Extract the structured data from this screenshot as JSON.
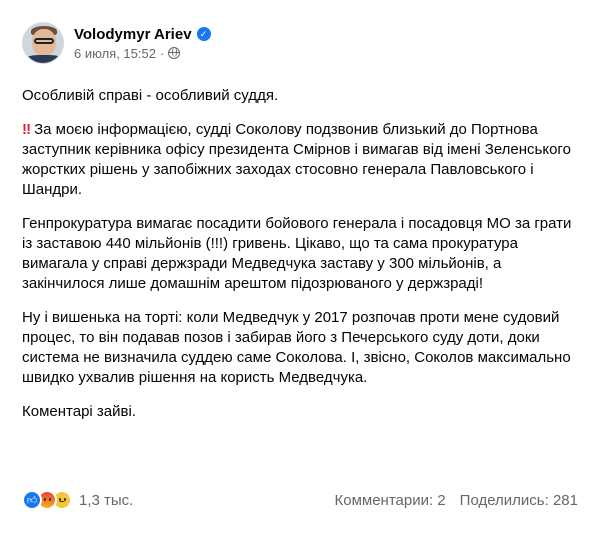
{
  "post": {
    "author": "Volodymyr Ariev",
    "date": "6 июля, 15:52",
    "dot": "·",
    "paragraphs": [
      "Особливій справі - особливий суддя.",
      "За моєю інформацією, судді Соколову подзвонив близький до Портнова заступник керівника офісу президента Смірнов і вимагав від імені Зеленського жорстких рішень у запобіжних заходах стосовно генерала Павловського і Шандри.",
      "Генпрокуратура вимагає посадити бойового генерала і посадовця МО за грати із заставою 440 мільйонів (!!!) гривень. Цікаво, що та сама прокуратура вимагала у справі держзради Медведчука заставу у 300 мільйонів, а закінчилося лише домашнім арештом підозрюваного у держзраді!",
      "Ну і вишенька на торті: коли Медведчук у 2017 розпочав проти мене судовий процес, то він подавав позов і забирав його з Печерського суду доти, доки система не визначила суддею саме Соколова. І, звісно, Соколов максимально швидко ухвалив рішення на користь Медведчука.",
      "Коментарі зайві."
    ],
    "alert_icon": "‼",
    "reactions": {
      "count": "1,3 тыс.",
      "types": [
        "like-icon",
        "angry-icon",
        "sad-icon"
      ]
    },
    "comments": "Комментарии: 2",
    "shares": "Поделились: 281"
  },
  "colors": {
    "verified": "#1877f2",
    "alert": "#e41e3f",
    "secondary_text": "#65676b"
  }
}
